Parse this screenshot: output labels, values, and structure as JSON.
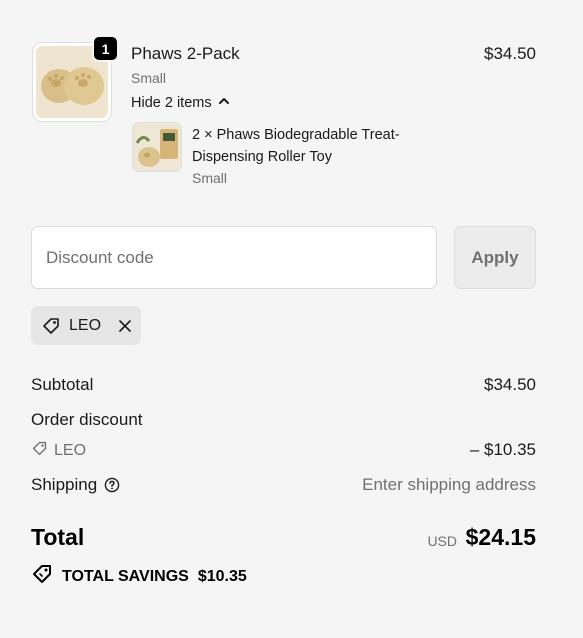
{
  "product": {
    "title": "Phaws 2-Pack",
    "variant": "Small",
    "price": "$34.50",
    "quantity": "1",
    "toggle_label": "Hide 2 items",
    "sub_item": {
      "title": "2 × Phaws Biodegradable Treat-Dispensing Roller Toy",
      "variant": "Small"
    }
  },
  "discount": {
    "placeholder": "Discount code",
    "value": "",
    "apply_label": "Apply",
    "applied_code": "LEO"
  },
  "summary": {
    "subtotal_label": "Subtotal",
    "subtotal_value": "$34.50",
    "order_discount_label": "Order discount",
    "discount_code": "LEO",
    "discount_value": "– $10.35",
    "shipping_label": "Shipping",
    "shipping_value": "Enter shipping address",
    "total_label": "Total",
    "currency": "USD",
    "total_value": "$24.15",
    "savings_label": "TOTAL SAVINGS",
    "savings_value": "$10.35"
  },
  "colors": {
    "background": "#f5f5f5",
    "muted_text": "#707070",
    "badge": "#000000"
  }
}
